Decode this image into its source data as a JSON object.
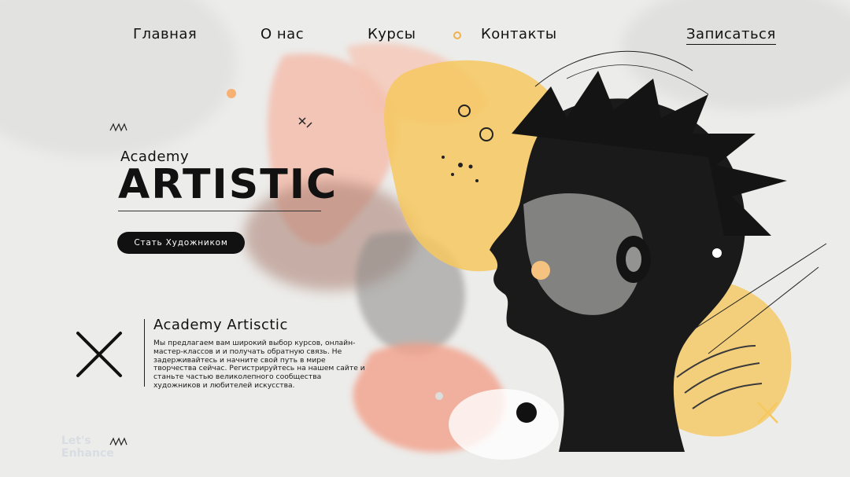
{
  "nav": {
    "items": [
      "Главная",
      "О нас",
      "Курсы",
      "Контакты"
    ],
    "signup": "Записаться"
  },
  "hero": {
    "subtitle": "Academy",
    "title": "ARTISTIC",
    "cta": "Стать Художником"
  },
  "about": {
    "title": "Academy Artisctic",
    "text": "Мы предлагаем вам широкий выбор курсов, онлайн-мастер-классов и  и получать обратную связь. Не задерживайтесь и начните свой путь в мире творчества сейчас. Регистрируйтесь на нашем сайте и станьте частью великолепного сообщества художников и любителей искусства."
  },
  "watermark": {
    "line1": "Let's",
    "line2": "Enhance"
  },
  "colors": {
    "accent_yellow": "#f6c85f",
    "accent_peach": "#f2a48e",
    "text_dark": "#111111",
    "background": "#ececea"
  },
  "icons": [
    "close-x-icon",
    "dot-icon"
  ]
}
